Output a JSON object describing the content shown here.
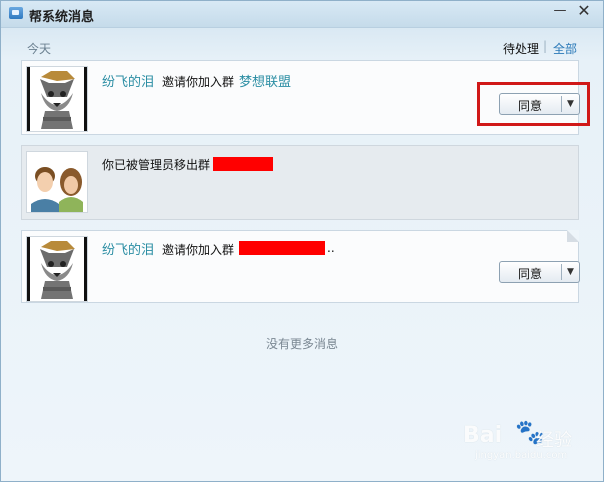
{
  "window": {
    "title": "帮系统消息",
    "minimize_glyph": "—",
    "close_glyph": "✕"
  },
  "header": {
    "date_label": "今天",
    "filter_pending": "待处理",
    "filter_sep": "|",
    "filter_all": "全部"
  },
  "messages": [
    {
      "sender": "纷飞的泪",
      "text": "邀请你加入群",
      "group": "梦想联盟",
      "action": "同意",
      "avatar_icon": "wolf-avatar-icon"
    },
    {
      "text": "你已被管理员移出群",
      "avatar_icon": "couple-avatar-icon"
    },
    {
      "sender": "纷飞的泪",
      "text": "邀请你加入群",
      "suffix": "..",
      "action": "同意",
      "avatar_icon": "wolf-avatar-icon"
    }
  ],
  "footer": {
    "no_more": "没有更多消息"
  },
  "watermark": {
    "brand": "Bai",
    "paw": "🐾",
    "product": "经验",
    "url": "jingyan.baidu.com"
  },
  "colors": {
    "accent_link": "#2a8da3",
    "highlight": "#d01818",
    "redaction": "#ff0000"
  }
}
